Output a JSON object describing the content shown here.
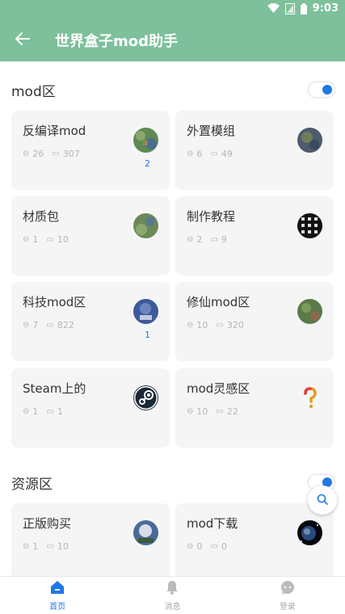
{
  "statusbar": {
    "time": "9:03"
  },
  "appbar": {
    "title": "世界盒子mod助手"
  },
  "sections": [
    {
      "title": "mod区",
      "toggle_on": true,
      "cards": [
        {
          "title": "反编译mod",
          "views": "26",
          "posts": "307",
          "badge": "2",
          "thumb": "thumb-green"
        },
        {
          "title": "外置模组",
          "views": "6",
          "posts": "49",
          "badge": "",
          "thumb": "thumb-map"
        },
        {
          "title": "材质包",
          "views": "1",
          "posts": "10",
          "badge": "",
          "thumb": "thumb-green"
        },
        {
          "title": "制作教程",
          "views": "2",
          "posts": "9",
          "badge": "",
          "thumb": "thumb-dark"
        },
        {
          "title": "科技mod区",
          "views": "7",
          "posts": "822",
          "badge": "1",
          "thumb": "thumb-blue"
        },
        {
          "title": "修仙mod区",
          "views": "10",
          "posts": "320",
          "badge": "",
          "thumb": "thumb-map"
        },
        {
          "title": "Steam上的",
          "views": "1",
          "posts": "1",
          "badge": "",
          "thumb": "steam-logo"
        },
        {
          "title": "mod灵感区",
          "views": "10",
          "posts": "22",
          "badge": "",
          "thumb": "question-icon"
        }
      ]
    },
    {
      "title": "资源区",
      "toggle_on": true,
      "cards": [
        {
          "title": "正版购买",
          "views": "1",
          "posts": "10",
          "badge": "",
          "thumb": "thumb-blue"
        },
        {
          "title": "mod下载",
          "views": "0",
          "posts": "0",
          "badge": "",
          "thumb": "thumb-space"
        }
      ]
    }
  ],
  "bottomnav": [
    {
      "label": "首页",
      "icon": "home-icon",
      "active": true
    },
    {
      "label": "消息",
      "icon": "bell-icon",
      "active": false
    },
    {
      "label": "登录",
      "icon": "chat-icon",
      "active": false
    }
  ],
  "colors": {
    "header": "#7dc09b",
    "accent": "#1e78e6",
    "card_bg": "#f5f5f5"
  }
}
